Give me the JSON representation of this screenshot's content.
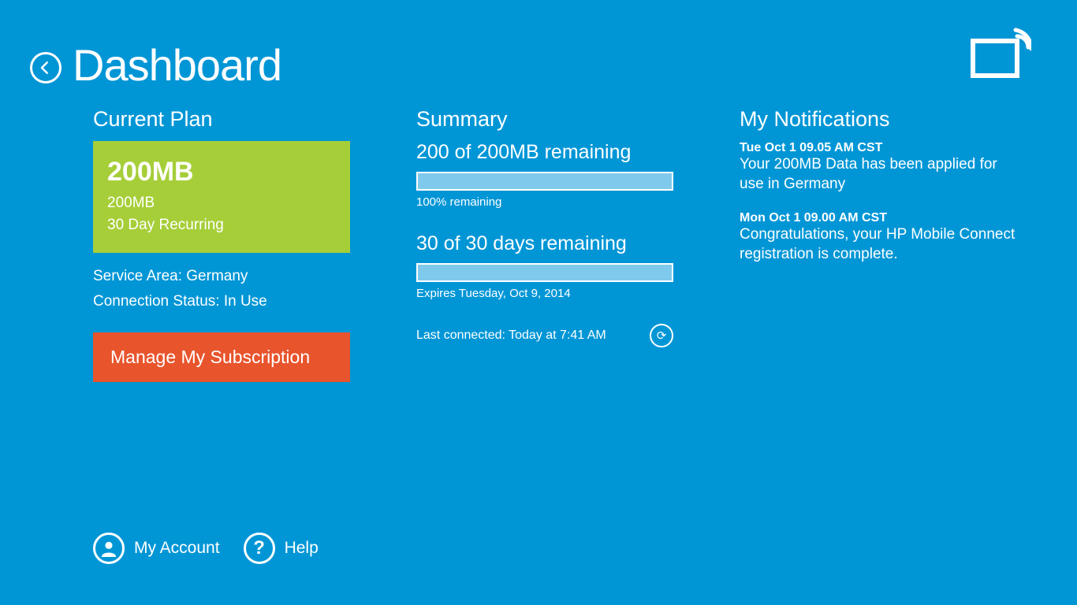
{
  "header": {
    "title": "Dashboard"
  },
  "plan": {
    "section_title": "Current Plan",
    "amount": "200MB",
    "sub_amount": "200MB",
    "recurring": "30 Day Recurring",
    "service_area": "Service Area: Germany",
    "connection_status": "Connection Status: In Use",
    "manage_label": "Manage My Subscription"
  },
  "summary": {
    "section_title": "Summary",
    "data_line": "200 of 200MB remaining",
    "data_caption": "100% remaining",
    "days_line": "30 of 30 days remaining",
    "days_caption": "Expires Tuesday, Oct 9, 2014",
    "last_connected": "Last connected: Today at 7:41 AM"
  },
  "notifications": {
    "section_title": "My Notifications",
    "items": [
      {
        "date": "Tue Oct 1  09.05 AM CST",
        "body": "Your 200MB Data has been applied for use in Germany"
      },
      {
        "date": "Mon Oct 1  09.00 AM CST",
        "body": "Congratulations, your HP Mobile Connect registration is complete."
      }
    ]
  },
  "footer": {
    "account": "My Account",
    "help": "Help"
  },
  "chart_data": [
    {
      "type": "bar",
      "title": "Data remaining",
      "categories": [
        "remaining"
      ],
      "values": [
        100
      ],
      "ylim": [
        0,
        100
      ],
      "xlabel": "",
      "ylabel": "% remaining"
    },
    {
      "type": "bar",
      "title": "Days remaining",
      "categories": [
        "remaining"
      ],
      "values": [
        100
      ],
      "ylim": [
        0,
        100
      ],
      "xlabel": "",
      "ylabel": "% remaining"
    }
  ]
}
